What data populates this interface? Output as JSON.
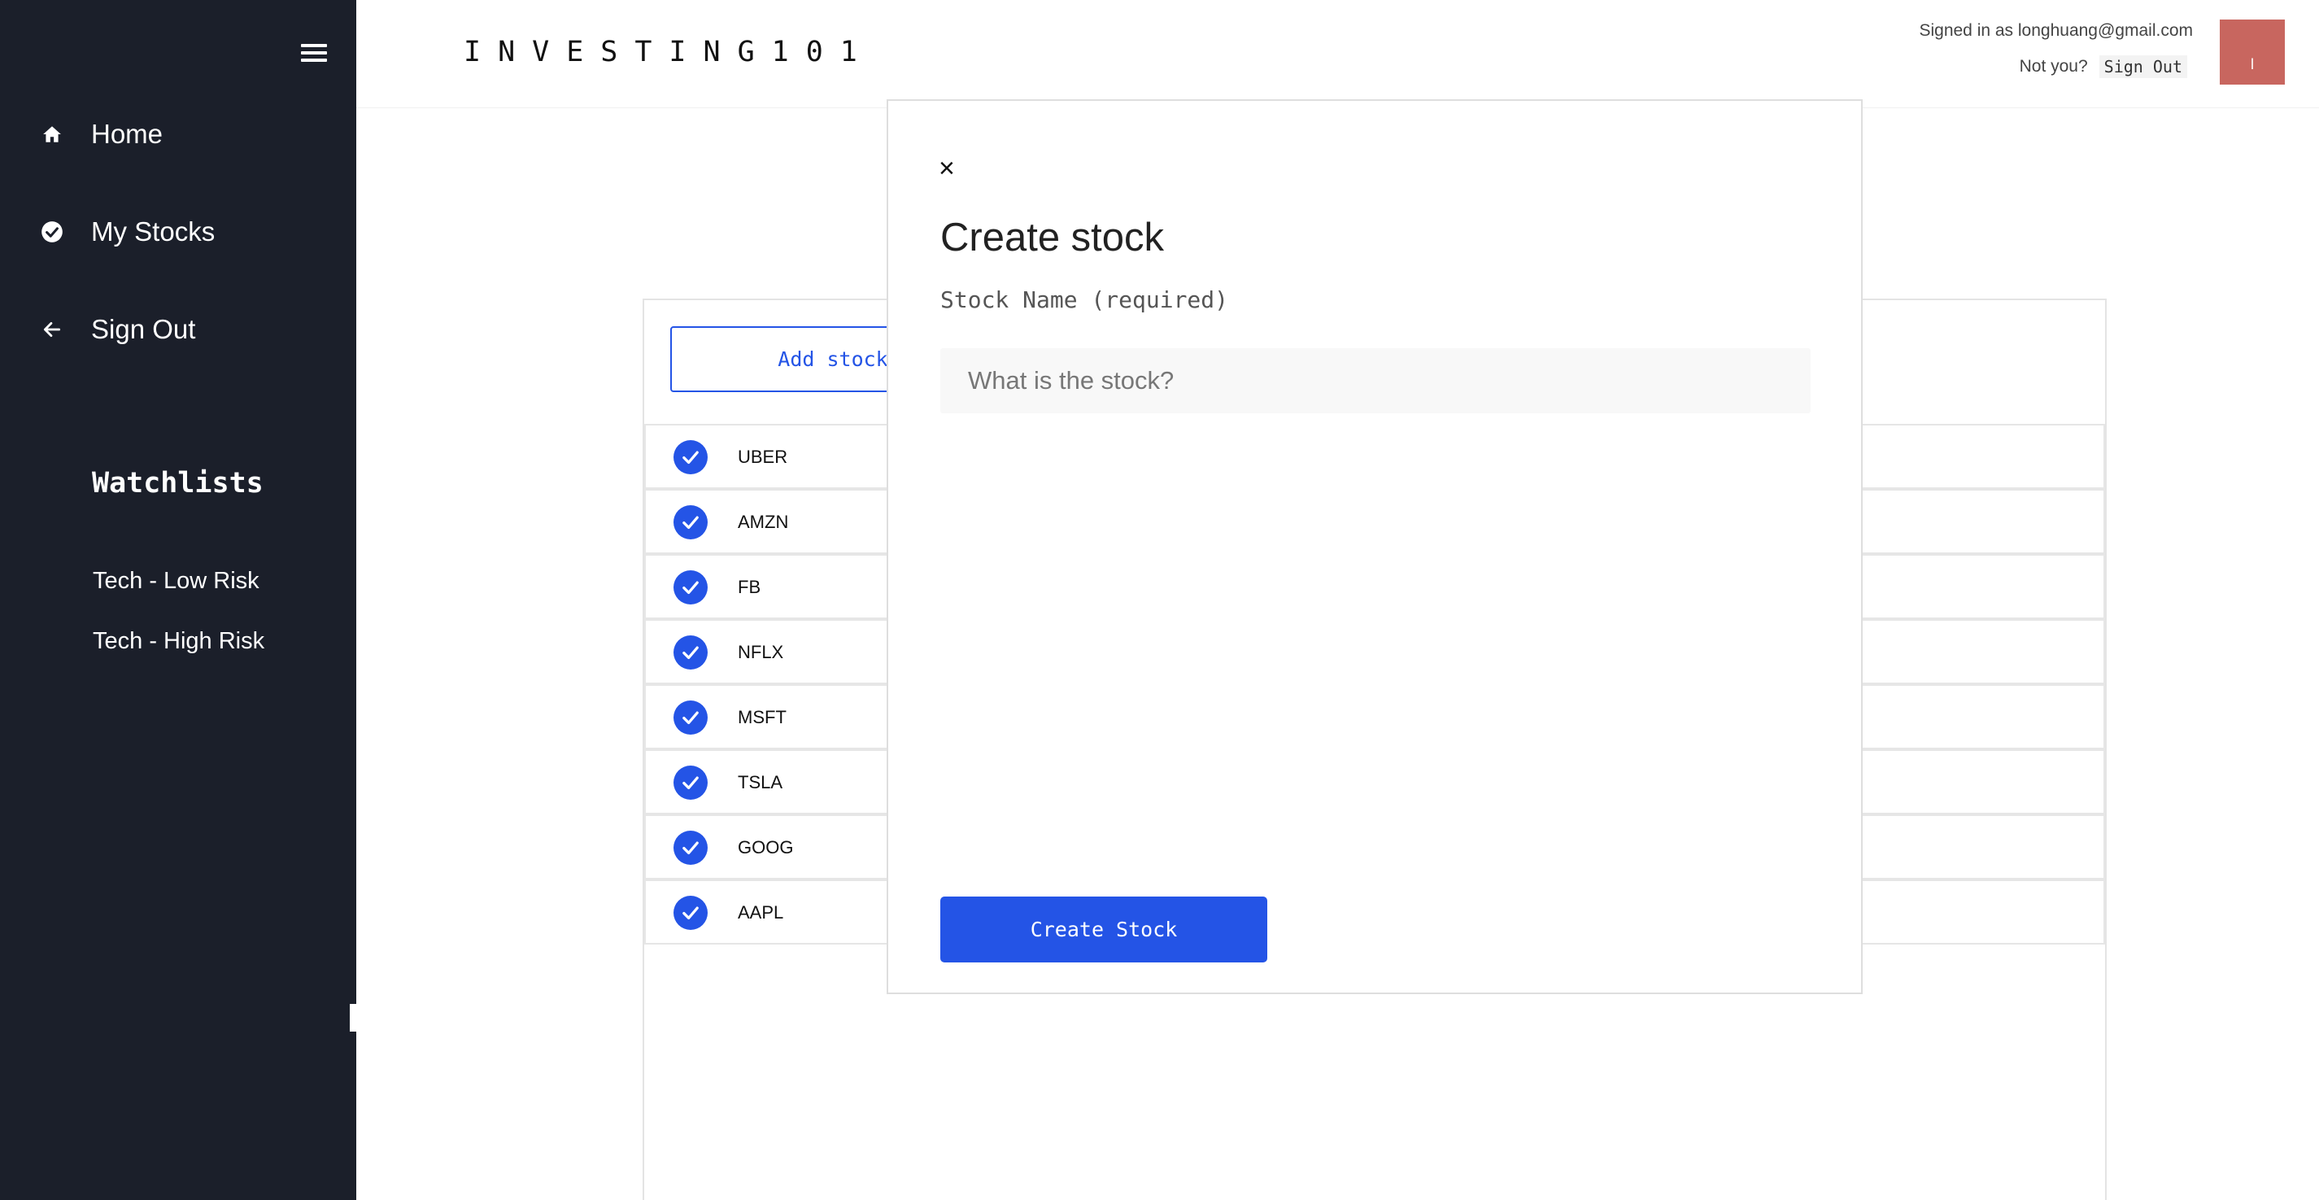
{
  "app": {
    "brand": "INVESTING101"
  },
  "sidebar": {
    "nav": [
      {
        "label": "Home",
        "icon": "home-icon"
      },
      {
        "label": "My Stocks",
        "icon": "check-circle-icon"
      },
      {
        "label": "Sign Out",
        "icon": "arrow-left-icon"
      }
    ],
    "watchlists_title": "Watchlists",
    "watchlists": [
      "Tech - Low Risk",
      "Tech - High Risk"
    ]
  },
  "header": {
    "signed_in_text": "Signed in as longhuang@gmail.com",
    "not_you": "Not you?",
    "sign_out": "Sign Out",
    "avatar_text": "l"
  },
  "stocks": {
    "add_label": "Add stock",
    "items": [
      "UBER",
      "AMZN",
      "FB",
      "NFLX",
      "MSFT",
      "TSLA",
      "GOOG",
      "AAPL"
    ]
  },
  "modal": {
    "close_symbol": "×",
    "title": "Create stock",
    "field_label": "Stock Name (required)",
    "placeholder": "What is the stock?",
    "submit_label": "Create Stock"
  },
  "colors": {
    "accent": "#2454e6",
    "sidebar": "#1b1f2a",
    "avatar": "#c8665f"
  }
}
